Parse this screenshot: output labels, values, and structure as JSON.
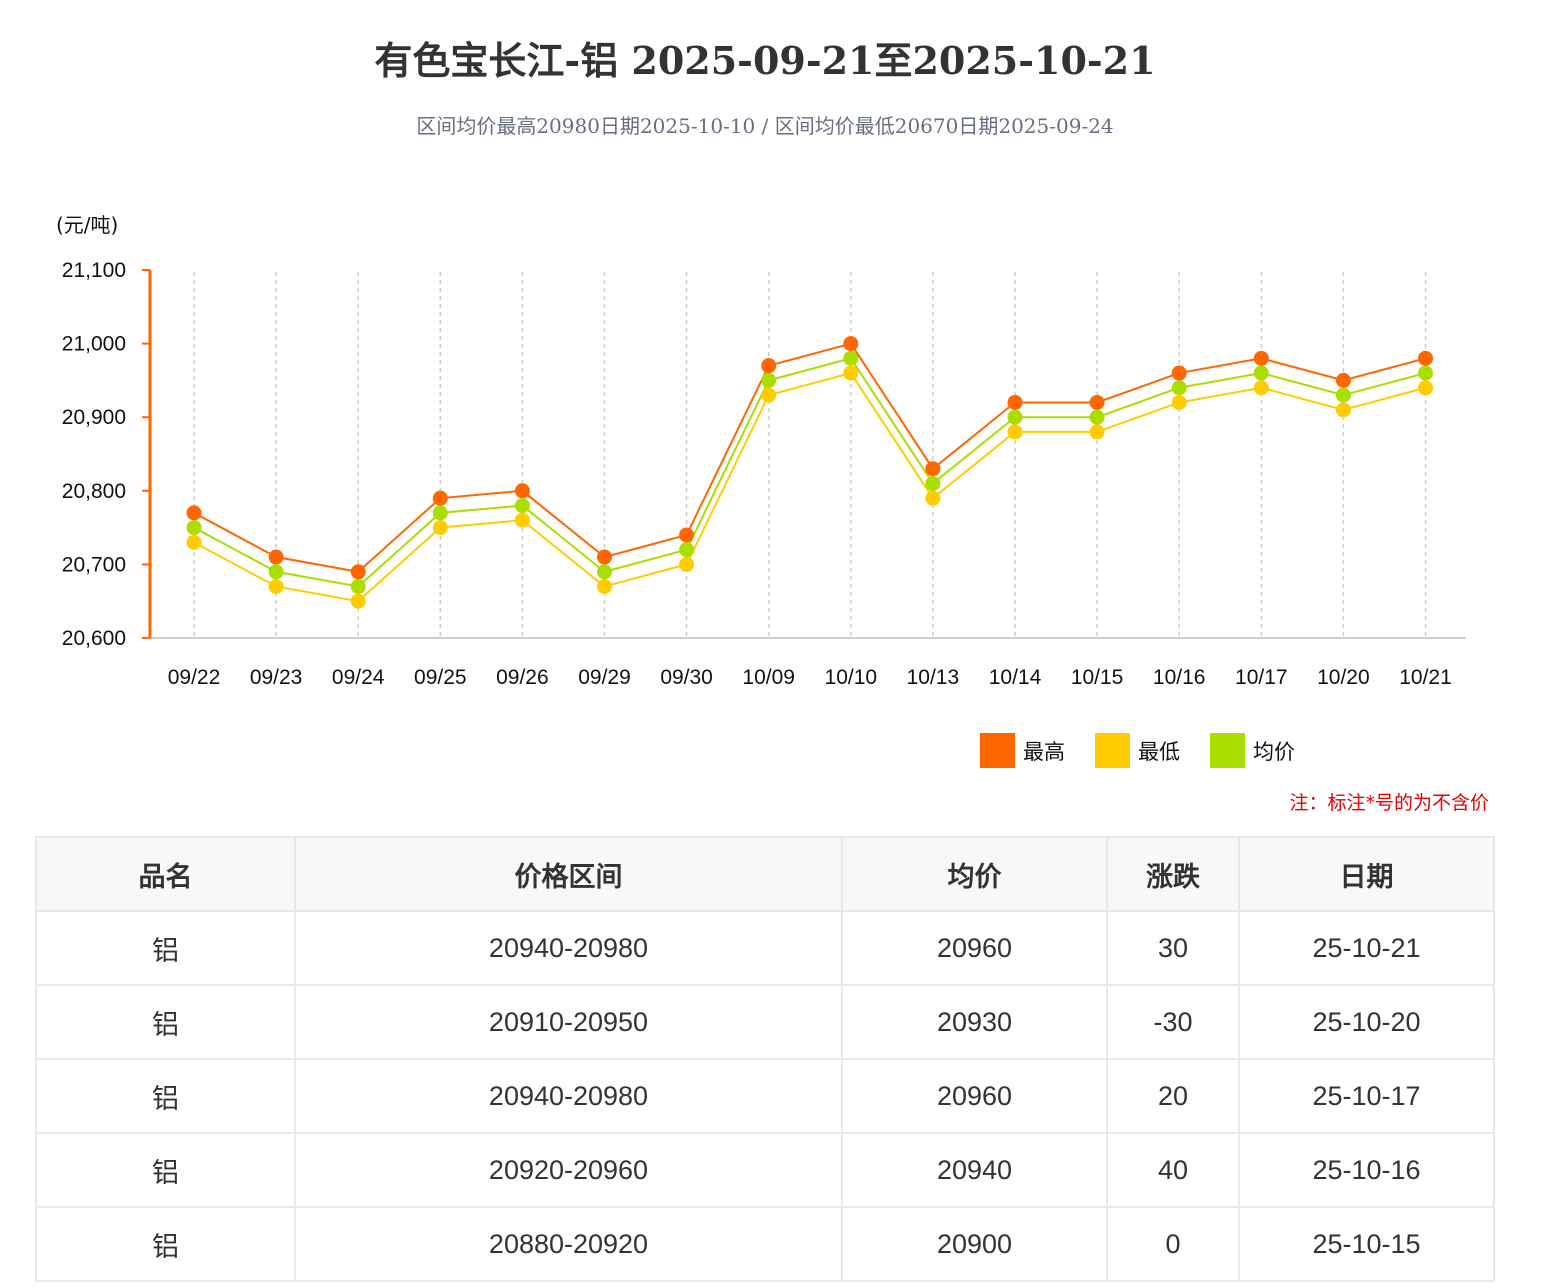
{
  "title": "有色宝长江-铝 2025-09-21至2025-10-21",
  "subtitle": "区间均价最高20980日期2025-10-10 / 区间均价最低20670日期2025-09-24",
  "note": "注：标注*号的为不含价",
  "table": {
    "headers": [
      "品名",
      "价格区间",
      "均价",
      "涨跌",
      "日期"
    ],
    "rows": [
      [
        "铝",
        "20940-20980",
        "20960",
        "30",
        "25-10-21"
      ],
      [
        "铝",
        "20910-20950",
        "20930",
        "-30",
        "25-10-20"
      ],
      [
        "铝",
        "20940-20980",
        "20960",
        "20",
        "25-10-17"
      ],
      [
        "铝",
        "20920-20960",
        "20940",
        "40",
        "25-10-16"
      ],
      [
        "铝",
        "20880-20920",
        "20900",
        "0",
        "25-10-15"
      ]
    ]
  },
  "chart_data": {
    "type": "line",
    "ylabel": "(元/吨)",
    "ylim": [
      20600,
      21100
    ],
    "yticks": [
      21100,
      21000,
      20900,
      20800,
      20700,
      20600
    ],
    "ytick_labels": [
      "21,100",
      "21,000",
      "20,900",
      "20,800",
      "20,700",
      "20,600"
    ],
    "grid": "vertical dashed",
    "legend_position": "bottom-right",
    "categories": [
      "09/22",
      "09/23",
      "09/24",
      "09/25",
      "09/26",
      "09/29",
      "09/30",
      "10/09",
      "10/10",
      "10/13",
      "10/14",
      "10/15",
      "10/16",
      "10/17",
      "10/20",
      "10/21"
    ],
    "series": [
      {
        "name": "最高",
        "color": "#ff6600",
        "values": [
          20770,
          20710,
          20690,
          20790,
          20800,
          20710,
          20740,
          20970,
          21000,
          20830,
          20920,
          20920,
          20960,
          20980,
          20950,
          20980
        ]
      },
      {
        "name": "最低",
        "color": "#ffcc00",
        "values": [
          20730,
          20670,
          20650,
          20750,
          20760,
          20670,
          20700,
          20930,
          20960,
          20790,
          20880,
          20880,
          20920,
          20940,
          20910,
          20940
        ]
      },
      {
        "name": "均价",
        "color": "#aadd00",
        "values": [
          20750,
          20690,
          20670,
          20770,
          20780,
          20690,
          20720,
          20950,
          20980,
          20810,
          20900,
          20900,
          20940,
          20960,
          20930,
          20960
        ]
      }
    ]
  }
}
